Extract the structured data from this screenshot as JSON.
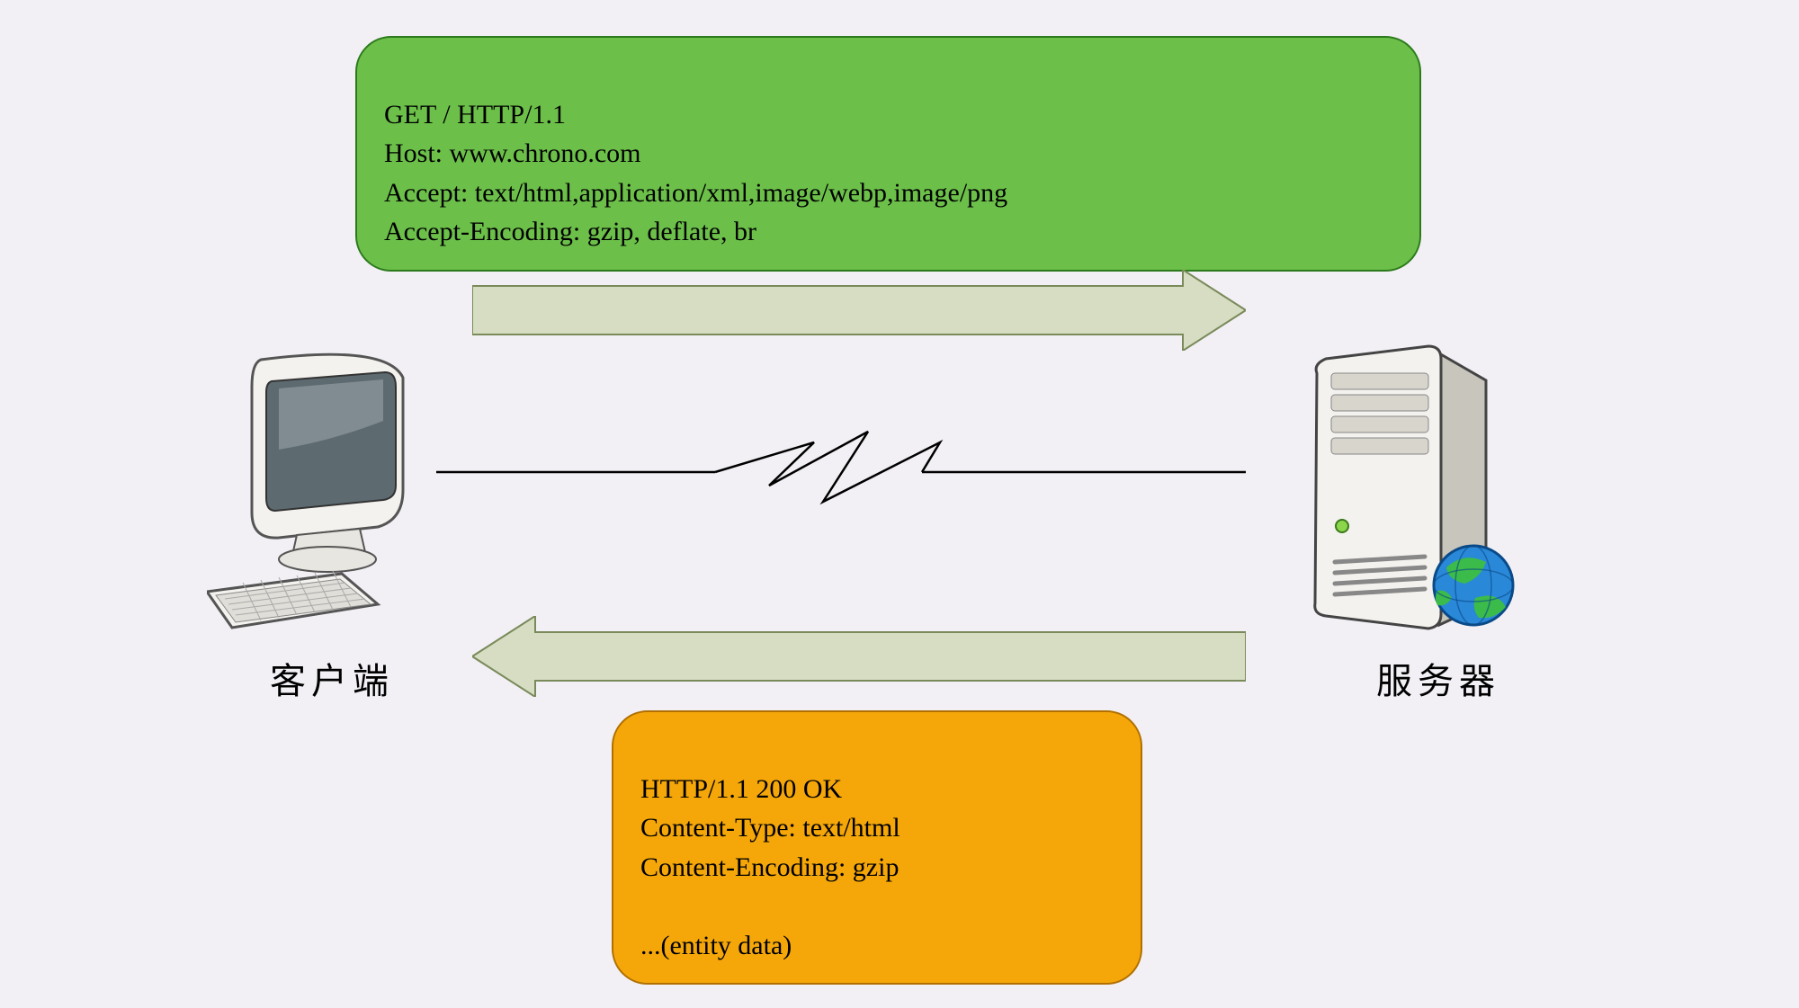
{
  "labels": {
    "client": "客户端",
    "server": "服务器"
  },
  "request": {
    "line1": "GET / HTTP/1.1",
    "line2": "Host: www.chrono.com",
    "line3": "Accept: text/html,application/xml,image/webp,image/png",
    "line4": "Accept-Encoding: gzip, deflate, br"
  },
  "response": {
    "line1": "HTTP/1.1 200 OK",
    "line2": "Content-Type: text/html",
    "line3": "Content-Encoding: gzip",
    "line4": "",
    "line5": "...(entity data)"
  },
  "colors": {
    "request_box": "#6cc04a",
    "response_box": "#f5a70a",
    "arrow_fill": "#d6ddc3",
    "background": "#f2f0f5"
  }
}
